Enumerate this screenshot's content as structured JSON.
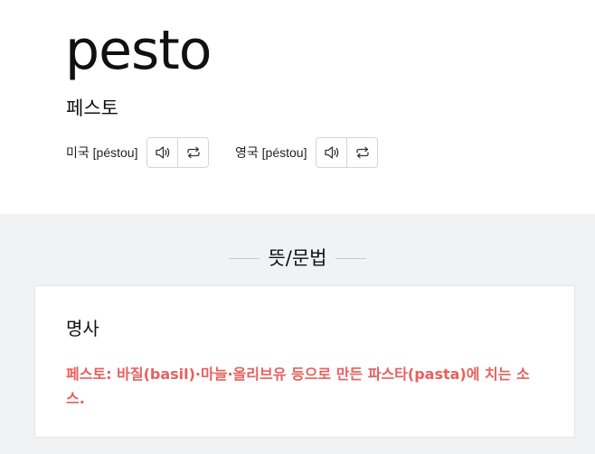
{
  "entry": {
    "word": "pesto",
    "korean_reading": "페스토"
  },
  "pronunciations": [
    {
      "label": "미국 [péstou]",
      "icons": [
        "speaker-icon",
        "repeat-icon"
      ]
    },
    {
      "label": "영국 [péstou]",
      "icons": [
        "speaker-icon",
        "repeat-icon"
      ]
    }
  ],
  "section": {
    "title": "뜻/문법"
  },
  "meaning": {
    "part_of_speech": "명사",
    "definition": "페스토: 바질(basil)·마늘·올리브유 등으로 만든 파스타(pasta)에 치는 소스."
  },
  "colors": {
    "definition": "#e8605d",
    "section_background": "#f1f2f4"
  }
}
